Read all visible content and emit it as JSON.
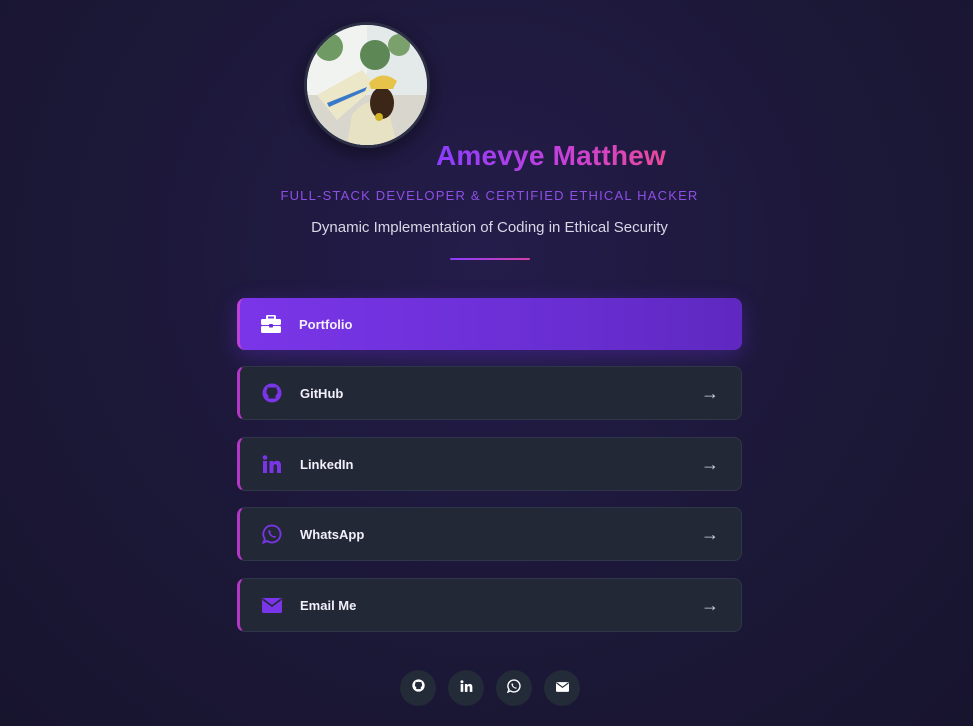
{
  "profile": {
    "name": "Amevye Matthew",
    "role": "FULL-STACK DEVELOPER & CERTIFIED ETHICAL HACKER",
    "tagline": "Dynamic Implementation of Coding in Ethical Security"
  },
  "links": [
    {
      "label": "Portfolio",
      "icon": "briefcase-icon",
      "arrow": ""
    },
    {
      "label": "GitHub",
      "icon": "github-icon",
      "arrow": "→"
    },
    {
      "label": "LinkedIn",
      "icon": "linkedin-icon",
      "arrow": "→"
    },
    {
      "label": "WhatsApp",
      "icon": "whatsapp-icon",
      "arrow": "→"
    },
    {
      "label": "Email Me",
      "icon": "email-icon",
      "arrow": "→"
    }
  ],
  "social": [
    {
      "icon": "github-icon"
    },
    {
      "icon": "linkedin-icon"
    },
    {
      "icon": "whatsapp-icon"
    },
    {
      "icon": "email-icon"
    }
  ],
  "colors": {
    "accent": "#7a35e8",
    "accent_pink": "#ec4a9a",
    "card_bg": "#222836",
    "page_bg": "#1c1838"
  }
}
